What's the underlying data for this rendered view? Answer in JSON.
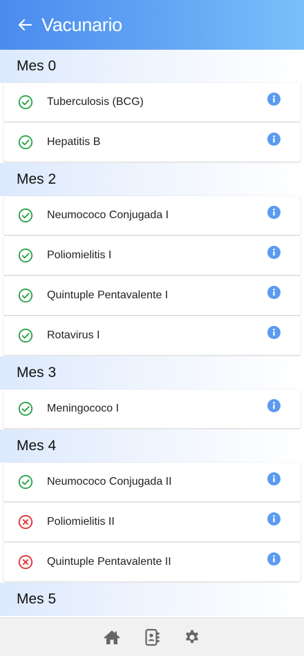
{
  "header": {
    "back_icon": "arrow-left-icon",
    "title": "Vacunario"
  },
  "colors": {
    "header_gradient_start": "#4a8bee",
    "header_gradient_end": "#7ac0fa",
    "status_done": "#2aa348",
    "status_missing": "#e23232",
    "info": "#5b9bf0",
    "nav_icon": "#666666"
  },
  "sections": [
    {
      "title": "Mes 0",
      "vaccines": [
        {
          "name": "Tuberculosis (BCG)",
          "status": "done"
        },
        {
          "name": "Hepatitis B",
          "status": "done"
        }
      ]
    },
    {
      "title": "Mes 2",
      "vaccines": [
        {
          "name": "Neumococo Conjugada I",
          "status": "done"
        },
        {
          "name": "Poliomielitis I",
          "status": "done"
        },
        {
          "name": "Quintuple Pentavalente I",
          "status": "done"
        },
        {
          "name": "Rotavirus I",
          "status": "done"
        }
      ]
    },
    {
      "title": "Mes 3",
      "vaccines": [
        {
          "name": "Meningococo I",
          "status": "done"
        }
      ]
    },
    {
      "title": "Mes 4",
      "vaccines": [
        {
          "name": "Neumococo Conjugada II",
          "status": "done"
        },
        {
          "name": "Poliomielitis II",
          "status": "missing"
        },
        {
          "name": "Quintuple Pentavalente II",
          "status": "missing"
        }
      ]
    },
    {
      "title": "Mes 5",
      "vaccines": []
    }
  ],
  "bottom_nav": [
    {
      "name": "home",
      "icon": "home-icon"
    },
    {
      "name": "contacts",
      "icon": "address-book-icon"
    },
    {
      "name": "settings",
      "icon": "gear-icon"
    }
  ]
}
